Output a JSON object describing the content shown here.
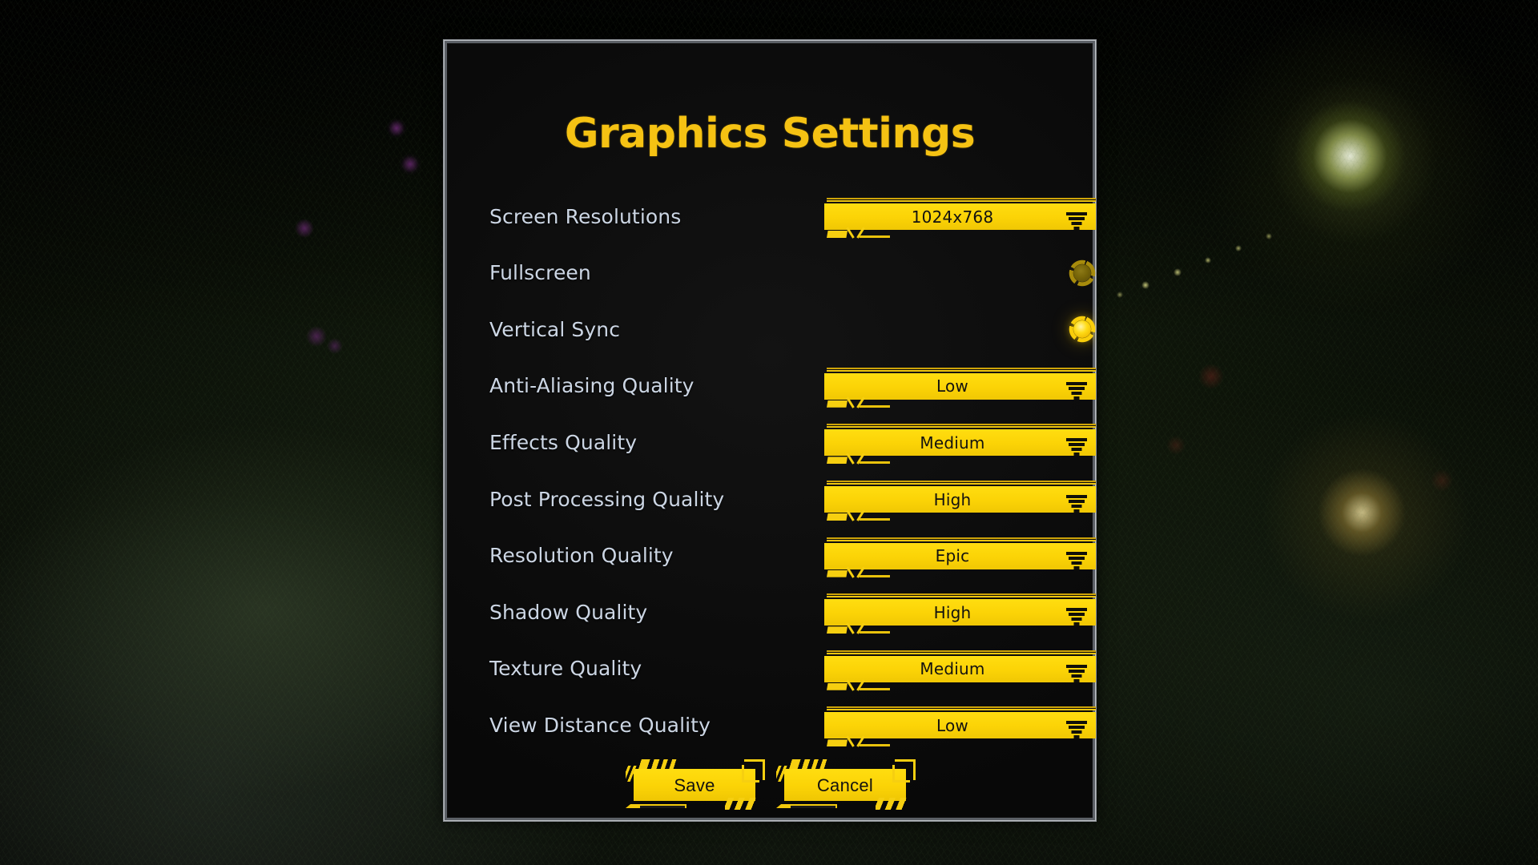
{
  "panel": {
    "title": "Graphics Settings",
    "accent_color": "#f5c213",
    "widget_color": "#fbd306",
    "label_color": "#ccd6e4",
    "frame_color": "#b9bdc2",
    "panel_bg": "#0d0d0d"
  },
  "settings": [
    {
      "label": "Screen Resolutions",
      "control": "dropdown",
      "value": "1024x768",
      "icon": "chevron-funnel-icon"
    },
    {
      "label": "Fullscreen",
      "control": "toggle",
      "value": "off",
      "icon": "radial-toggle-icon"
    },
    {
      "label": "Vertical Sync",
      "control": "toggle",
      "value": "on",
      "icon": "radial-toggle-icon"
    },
    {
      "label": "Anti-Aliasing Quality",
      "control": "dropdown",
      "value": "Low",
      "icon": "chevron-funnel-icon"
    },
    {
      "label": "Effects Quality",
      "control": "dropdown",
      "value": "Medium",
      "icon": "chevron-funnel-icon"
    },
    {
      "label": "Post Processing Quality",
      "control": "dropdown",
      "value": "High",
      "icon": "chevron-funnel-icon"
    },
    {
      "label": "Resolution Quality",
      "control": "dropdown",
      "value": "Epic",
      "icon": "chevron-funnel-icon"
    },
    {
      "label": "Shadow Quality",
      "control": "dropdown",
      "value": "High",
      "icon": "chevron-funnel-icon"
    },
    {
      "label": "Texture Quality",
      "control": "dropdown",
      "value": "Medium",
      "icon": "chevron-funnel-icon"
    },
    {
      "label": "View Distance Quality",
      "control": "dropdown",
      "value": "Low",
      "icon": "chevron-funnel-icon"
    }
  ],
  "buttons": {
    "save_label": "Save",
    "cancel_label": "Cancel"
  }
}
